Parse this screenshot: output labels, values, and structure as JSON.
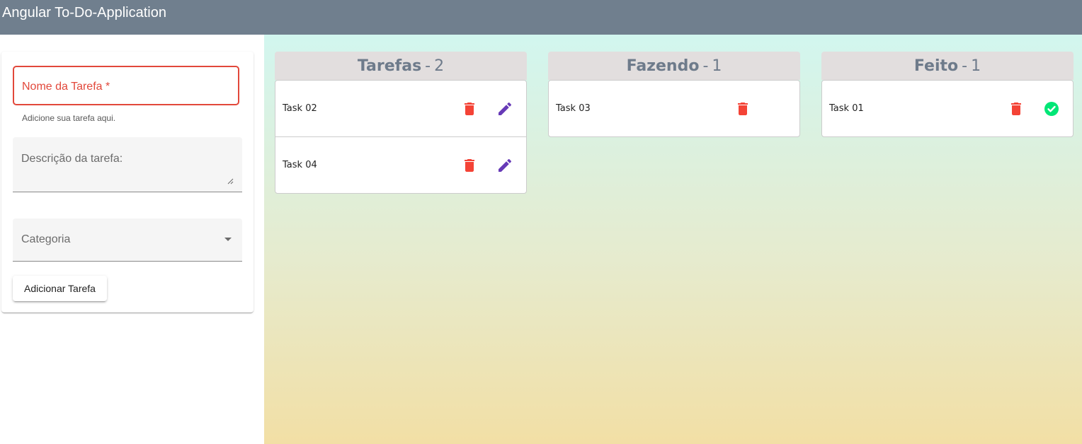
{
  "header": {
    "title": "Angular To-Do-Application"
  },
  "form": {
    "name_label": "Nome da Tarefa *",
    "name_hint": "Adicione sua tarefa aqui.",
    "description_label": "Descrição da tarefa:",
    "category_label": "Categoria",
    "submit_label": "Adicionar Tarefa"
  },
  "colors": {
    "header_bg": "#707f8e",
    "error": "#e2483b",
    "delete_icon": "#f44336",
    "edit_icon": "#673ab7",
    "done_icon": "#00e676",
    "column_header_bg": "#e2dede",
    "column_header_text": "#6e7b8b"
  },
  "columns": [
    {
      "name": "Tarefas",
      "separator": "-",
      "count": "2",
      "tasks": [
        {
          "label": "Task 02",
          "actions": [
            "delete-icon",
            "edit-icon"
          ]
        },
        {
          "label": "Task 04",
          "actions": [
            "delete-icon",
            "edit-icon"
          ]
        }
      ]
    },
    {
      "name": "Fazendo",
      "separator": "-",
      "count": "1",
      "tasks": [
        {
          "label": "Task 03",
          "actions": [
            "delete-icon"
          ]
        }
      ]
    },
    {
      "name": "Feito",
      "separator": "-",
      "count": "1",
      "tasks": [
        {
          "label": "Task 01",
          "actions": [
            "delete-icon",
            "check-circle-icon"
          ]
        }
      ]
    }
  ]
}
